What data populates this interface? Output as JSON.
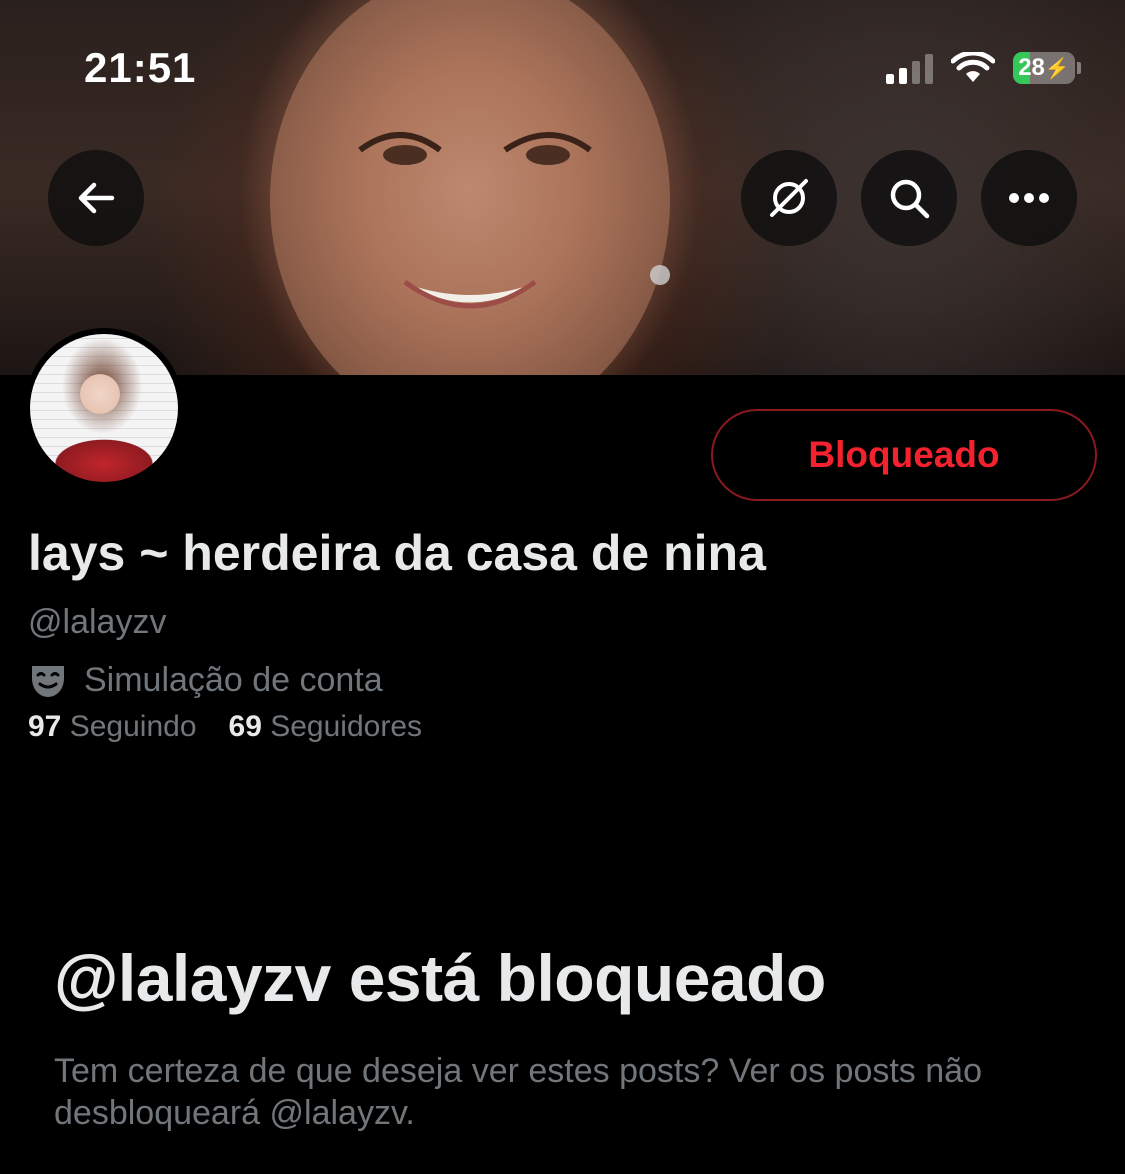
{
  "status_bar": {
    "time": "21:51",
    "battery": "28",
    "battery_level": 0.28
  },
  "header": {
    "back_icon": "arrow-left-icon",
    "grok_icon": "grok-icon",
    "search_icon": "search-icon",
    "more_icon": "more-horizontal-icon"
  },
  "profile": {
    "display_name": "lays ~ herdeira da casa de nina",
    "handle": "@lalayzv",
    "parody_label": "Simulação de conta",
    "following_count": "97",
    "following_label": "Seguindo",
    "followers_count": "69",
    "followers_label": "Seguidores",
    "blocked_button": "Bloqueado"
  },
  "blocked_notice": {
    "title": "@lalayzv está bloqueado",
    "description": "Tem certeza de que deseja ver estes posts? Ver os posts não desbloqueará @lalayzv."
  },
  "colors": {
    "accent_red": "#f4212e",
    "muted_text": "#71767b",
    "text": "#e7e9ea",
    "background": "#000000"
  }
}
